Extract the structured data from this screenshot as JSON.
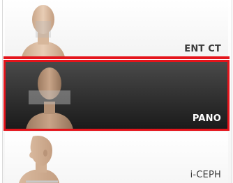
{
  "modes": [
    {
      "label": "ENT CT",
      "icon": "head-front-icon",
      "selected": false
    },
    {
      "label": "PANO",
      "icon": "head-front-highlight-icon",
      "selected": true
    },
    {
      "label": "i-CEPH",
      "icon": "head-profile-icon",
      "selected": false
    }
  ],
  "colors": {
    "selection": "#e4141b",
    "selected_background": "#2c2c2c",
    "label_dark": "#3a3a3a",
    "label_light": "#ffffff"
  }
}
